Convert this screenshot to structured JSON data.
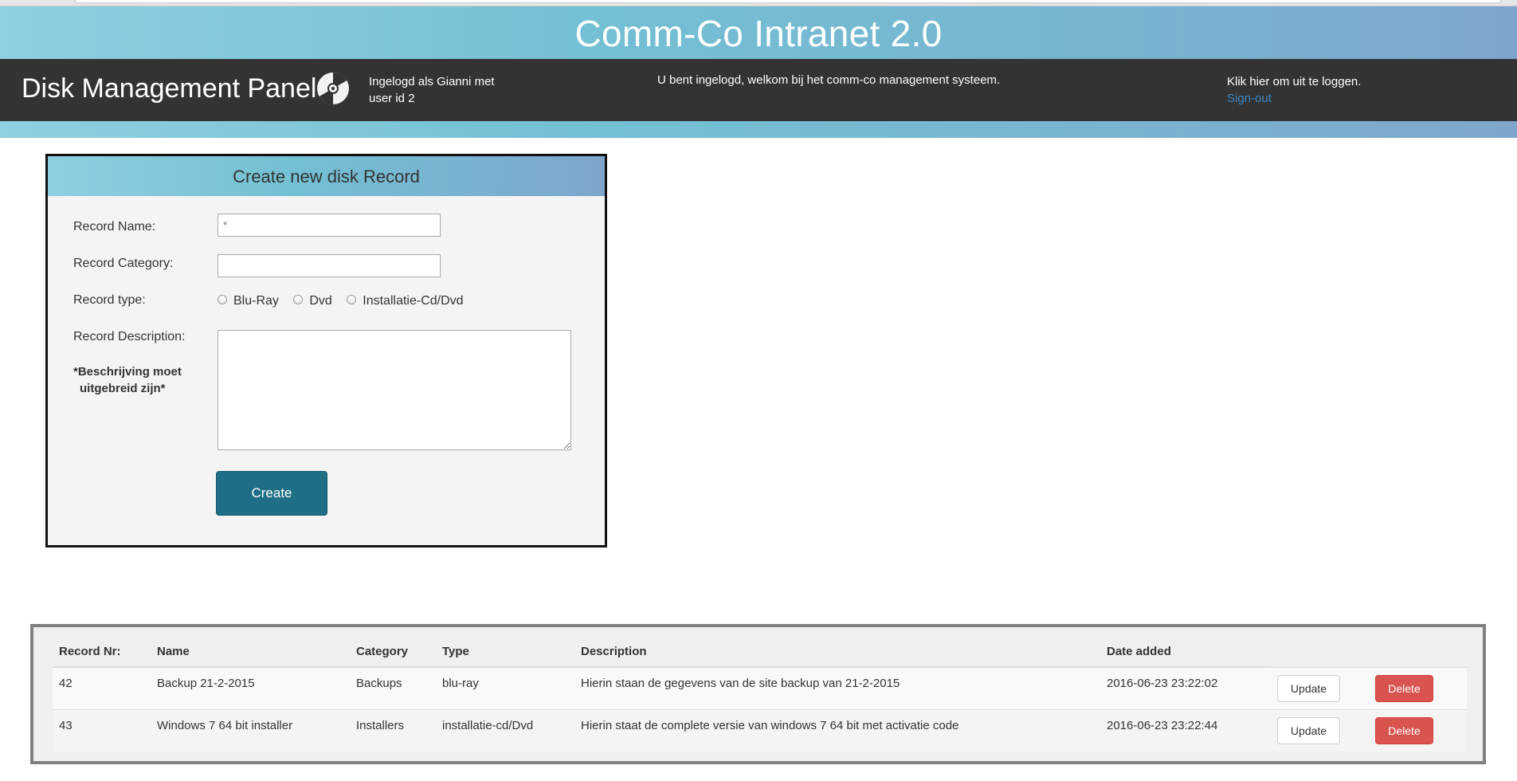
{
  "app_title": "Comm-Co Intranet 2.0",
  "nav": {
    "panel_title": "Disk Management Panel",
    "user_info_line1": "Ingelogd als Gianni met",
    "user_info_line2": "user id 2",
    "welcome": "U bent ingelogd, welkom bij het comm-co management systeem.",
    "logout_prompt": "Klik hier om uit te loggen.",
    "signout_label": "Sign-out"
  },
  "form": {
    "title": "Create new disk Record",
    "record_name_label": "Record Name:",
    "record_name_placeholder": "*",
    "record_category_label": "Record Category:",
    "record_type_label": "Record type:",
    "record_types": [
      "Blu-Ray",
      "Dvd",
      "Installatie-Cd/Dvd"
    ],
    "record_description_label": "Record Description:",
    "note_line1": "*Beschrijving moet",
    "note_line2": "uitgebreid zijn*",
    "create_label": "Create"
  },
  "table": {
    "headers": [
      "Record Nr:",
      "Name",
      "Category",
      "Type",
      "Description",
      "Date added"
    ],
    "rows": [
      {
        "nr": "42",
        "name": "Backup 21-2-2015",
        "category": "Backups",
        "type": "blu-ray",
        "description": "Hierin staan de gegevens van de site backup van 21-2-2015",
        "date": "2016-06-23 23:22:02",
        "update_label": "Update",
        "delete_label": "Delete"
      },
      {
        "nr": "43",
        "name": "Windows 7 64 bit installer",
        "category": "Installers",
        "type": "installatie-cd/Dvd",
        "description": "Hierin staat de complete versie van windows 7 64 bit met activatie code",
        "date": "2016-06-23 23:22:44",
        "update_label": "Update",
        "delete_label": "Delete"
      }
    ]
  },
  "colors": {
    "banner_gradient_start": "#8fcfdf",
    "banner_gradient_end": "#7ea6cc",
    "navbar": "#333333",
    "create_button": "#1e6f86",
    "delete_button": "#d9534f",
    "signout_link": "#3a87c8"
  },
  "icons": {
    "disk": "disk-icon"
  }
}
